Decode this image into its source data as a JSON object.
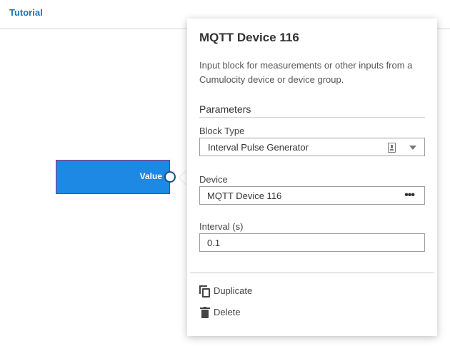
{
  "header": {
    "tab_label": "Tutorial"
  },
  "canvas": {
    "block": {
      "output_label": "Value"
    }
  },
  "panel": {
    "title": "MQTT Device 116",
    "description": "Input block for measurements or other inputs from a Cumulocity device or device group.",
    "parameters_heading": "Parameters",
    "block_type": {
      "label": "Block Type",
      "value": "Interval Pulse Generator",
      "icon": "chip-icon"
    },
    "device": {
      "label": "Device",
      "value": "MQTT Device 116",
      "more_glyph": "•••"
    },
    "interval": {
      "label": "Interval (s)",
      "value": "0.1"
    },
    "actions": {
      "duplicate": "Duplicate",
      "delete": "Delete"
    }
  },
  "colors": {
    "accent": "#1776bf",
    "block_fill": "#1e88e5",
    "block_border": "#a0306a",
    "port_border": "#1f4b7a"
  }
}
